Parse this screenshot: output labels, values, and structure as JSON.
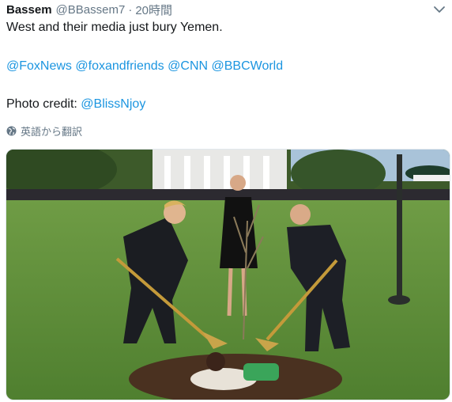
{
  "tweet": {
    "display_name": "Bassem",
    "handle": "@BBassem7",
    "separator": "·",
    "time": "20時間",
    "text_line1": "West and their media just bury Yemen.",
    "mentions": [
      "@FoxNews",
      "@foxandfriends",
      "@CNN",
      "@BBCWorld"
    ],
    "credit_label": "Photo credit: ",
    "credit_mention": "@BlissNjoy",
    "translate_label": "英語から翻訳"
  },
  "icons": {
    "caret": "chevron-down-icon",
    "translate": "globe-icon"
  },
  "colors": {
    "link": "#1b95e0",
    "muted": "#657786",
    "text": "#14171a"
  }
}
